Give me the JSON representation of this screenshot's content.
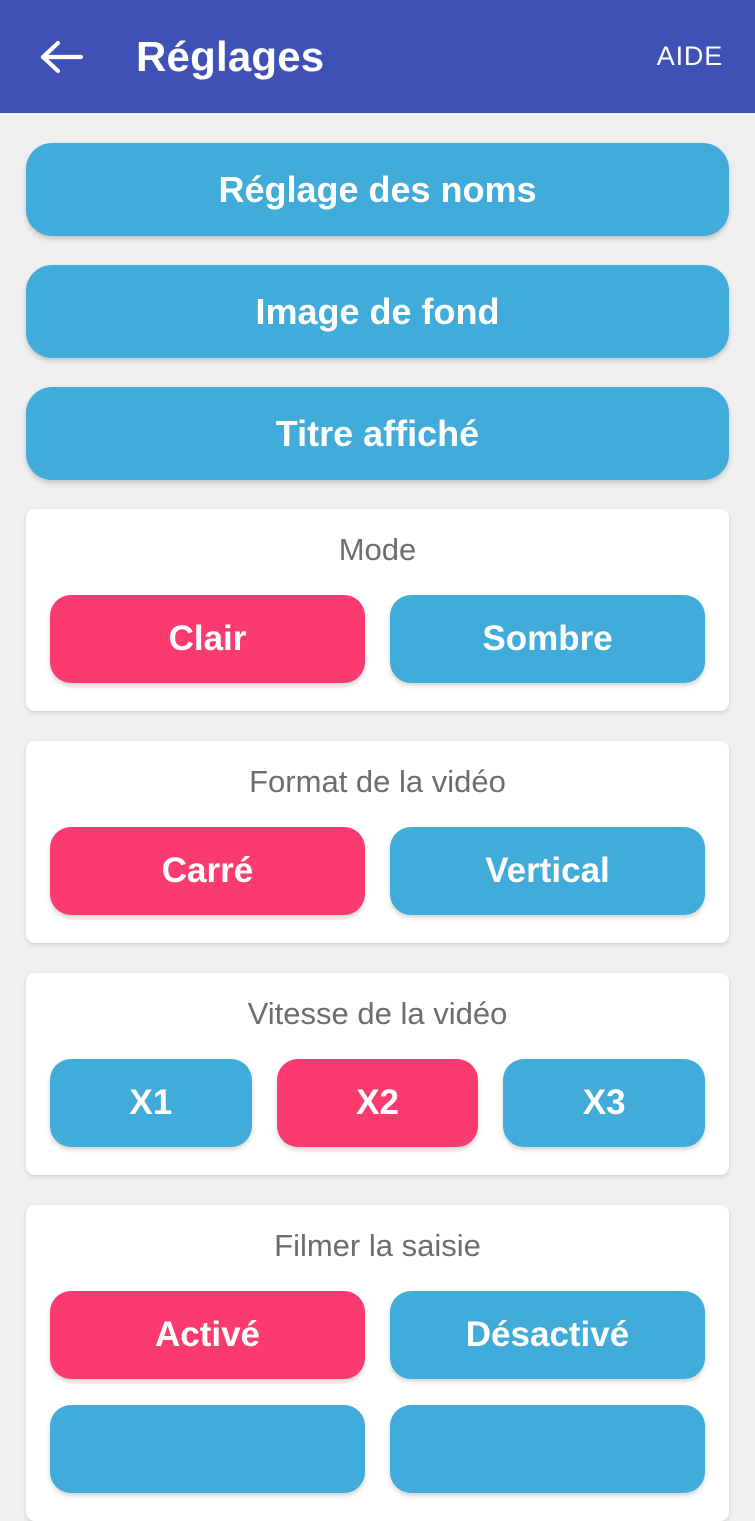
{
  "appbar": {
    "back_icon": "arrow-left-icon",
    "title": "Réglages",
    "action_label": "AIDE",
    "background_color": "#3f51b5",
    "text_color": "#ffffff"
  },
  "theme": {
    "page_background": "#efeff0",
    "card_background": "#ffffff",
    "accent_blue": "#41abda",
    "accent_pink": "#fb3b6f",
    "label_gray": "#6d6d6d"
  },
  "nav_buttons": [
    {
      "label": "Réglage des noms"
    },
    {
      "label": "Image de fond"
    },
    {
      "label": "Titre affiché"
    }
  ],
  "setting_groups": [
    {
      "label": "Mode",
      "options": [
        {
          "label": "Clair",
          "selected": true
        },
        {
          "label": "Sombre",
          "selected": false
        }
      ]
    },
    {
      "label": "Format de la vidéo",
      "options": [
        {
          "label": "Carré",
          "selected": true
        },
        {
          "label": "Vertical",
          "selected": false
        }
      ]
    },
    {
      "label": "Vitesse de la vidéo",
      "options": [
        {
          "label": "X1",
          "selected": false
        },
        {
          "label": "X2",
          "selected": true
        },
        {
          "label": "X3",
          "selected": false
        }
      ]
    },
    {
      "label": "Filmer la saisie",
      "options": [
        {
          "label": "Activé",
          "selected": true
        },
        {
          "label": "Désactivé",
          "selected": false
        }
      ],
      "extra_row": [
        {
          "label": "",
          "selected": false
        },
        {
          "label": "",
          "selected": false
        }
      ]
    }
  ]
}
